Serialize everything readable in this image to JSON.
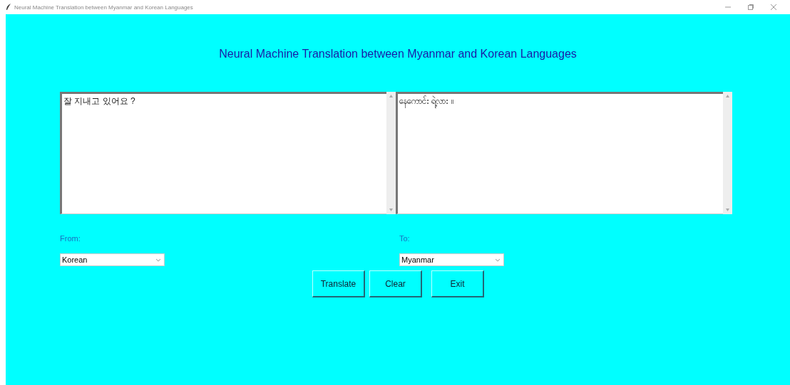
{
  "window": {
    "title": "Neural Machine Translation between Myanmar and Korean Languages"
  },
  "heading": "Neural Machine Translation between Myanmar and Korean Languages",
  "source_text": "잘 지내고 있어요 ?",
  "target_text": "နေကောင်း ရဲ့လား ။",
  "from": {
    "label": "From:",
    "value": "Korean"
  },
  "to": {
    "label": "To:",
    "value": "Myanmar"
  },
  "buttons": [
    "Translate",
    "Clear",
    "Exit"
  ]
}
